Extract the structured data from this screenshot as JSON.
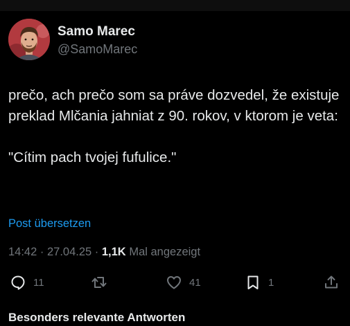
{
  "author": {
    "name": "Samo Marec",
    "handle": "@SamoMarec"
  },
  "tweet": {
    "paragraph1": "prečo, ach prečo som sa práve dozvedel, že existuje preklad Mlčania jahniat z 90. rokov, v ktorom je veta:",
    "paragraph2": "\"Cítim pach tvojej fufulice.\""
  },
  "translate_label": "Post übersetzen",
  "meta": {
    "time": "14:42",
    "separator1": " · ",
    "date": "27.04.25",
    "separator2": " · ",
    "views_count": "1,1K",
    "views_label": " Mal angezeigt"
  },
  "actions": {
    "replies": "11",
    "reposts": "",
    "likes": "41",
    "bookmarks": "1"
  },
  "icons": {
    "reply": "reply-icon",
    "repost": "repost-icon",
    "like": "heart-icon",
    "bookmark": "bookmark-icon",
    "share": "share-icon"
  },
  "replies_header": "Besonders relevante Antworten",
  "colors": {
    "background": "#000000",
    "text": "#e7e9ea",
    "secondary": "#71767b",
    "link": "#1d9bf0"
  }
}
